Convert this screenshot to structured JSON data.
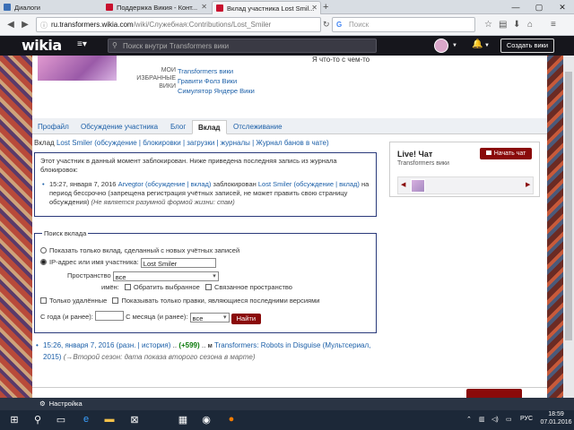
{
  "browser": {
    "tabs": [
      {
        "label": "Диалоги",
        "favicon_color": "#3b6fb6"
      },
      {
        "label": "Поддержка Викия - Конт...",
        "favicon_color": "#c8102e"
      },
      {
        "label": "Вклад участника Lost Smil...",
        "favicon_color": "#c8102e"
      }
    ],
    "url_host": "ru.transformers.wikia.com",
    "url_path": "/wiki/Служебная:Contributions/Lost_Smiler",
    "search_placeholder": "Поиск",
    "new_tab": "+",
    "min": "—",
    "max": "▢",
    "close": "✕"
  },
  "wikia": {
    "logo": "wikia",
    "search_placeholder": "Поиск внутри Transformers вики",
    "create_wiki": "Создать вики"
  },
  "profile": {
    "top_note": "Я что-то с чем-то",
    "favorites_label": "МОИ ИЗБРАННЫЕ ВИКИ",
    "favorites": [
      "Transformers вики",
      "Гравити Фолз Вики",
      "Симулятор Яндере Вики"
    ]
  },
  "tabs": [
    "Профайл",
    "Обсуждение участника",
    "Блог",
    "Вклад",
    "Отслеживание"
  ],
  "contrib_line": {
    "prefix": "Вклад",
    "user": "Lost Smiler",
    "links": "(обсуждение | блокировки | загрузки | журналы | Журнал банов в чате)"
  },
  "block_notice": {
    "text": "Этот участник в данный момент заблокирован. Ниже приведена последняя запись из журнала блокировок:",
    "date": "15:27, января 7, 2016",
    "admin": "Arvegtor",
    "admin_links": "(обсуждение | вклад)",
    "action": "заблокирован",
    "target": "Lost Smiler",
    "target_links": "(обсуждение | вклад)",
    "period": "на период бессрочно (запрещена регистрация учётных записей, не может править свою страницу обсуждения)",
    "reason": "(Не является разумной формой жизни: спам)"
  },
  "search_form": {
    "legend": "Поиск вклада",
    "opt_new": "Показать только вклад, сделанный с новых учётных записей",
    "opt_ip": "IP-адрес или имя участника:",
    "ip_value": "Lost Smiler",
    "ns_label": "Пространство",
    "ns_label2": "имён:",
    "ns_value": "все",
    "invert": "Обратить выбранное",
    "associated": "Связанное пространство",
    "deleted_only": "Только удалённые",
    "latest_only": "Показывать только правки, являющиеся последними версиями",
    "from_year": "С года (и ранее):",
    "from_month": "С месяца (и ранее):",
    "month_value": "все",
    "submit": "Найти"
  },
  "result": {
    "date": "15:26, января 7, 2016",
    "links": "(разн. | история)",
    "dots": "..",
    "diff": "(+599)",
    "dots2": "..",
    "minor": "м",
    "page": "Transformers: Robots in Disguise (Мультсериал, 2015)",
    "section": "(→Второй сезон:",
    "summary": "дата показа второго сезона в марте)"
  },
  "chat": {
    "title": "Live! Чат",
    "subtitle": "Transformers вики",
    "button": "Начать чат"
  },
  "taskbar": {
    "notif": "Настройка",
    "lang": "РУС",
    "time": "18:59",
    "date": "07.01.2016"
  }
}
